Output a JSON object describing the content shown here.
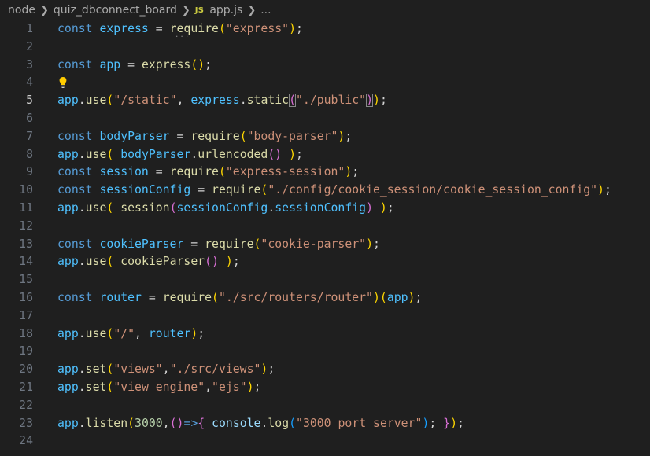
{
  "breadcrumb": {
    "items": [
      "node",
      "quiz_dbconnect_board"
    ],
    "file_icon": "JS",
    "file": "app.js",
    "more": "..."
  },
  "editor": {
    "language": "javascript",
    "current_line": 5,
    "line_numbers": [
      "1",
      "2",
      "3",
      "4",
      "5",
      "6",
      "7",
      "8",
      "9",
      "10",
      "11",
      "12",
      "13",
      "14",
      "15",
      "16",
      "17",
      "18",
      "19",
      "20",
      "21",
      "22",
      "23",
      "24"
    ],
    "lines": [
      "const express = require(\"express\");",
      "",
      "const app = express();",
      "",
      "app.use(\"/static\", express.static(\"./public\"));",
      "",
      "const bodyParser = require(\"body-parser\");",
      "app.use( bodyParser.urlencoded() );",
      "const session = require(\"express-session\");",
      "const sessionConfig = require(\"./config/cookie_session/cookie_session_config\");",
      "app.use( session(sessionConfig.sessionConfig) );",
      "",
      "const cookieParser = require(\"cookie-parser\");",
      "app.use( cookieParser() );",
      "",
      "const router = require(\"./src/routers/router\")(app);",
      "",
      "app.use(\"/\", router);",
      "",
      "app.set(\"views\",\"./src/views\");",
      "app.set(\"view engine\",\"ejs\");",
      "",
      "app.listen(3000,()=>{ console.log(\"3000 port server\"); });",
      ""
    ],
    "lightbulb_icon": "lightbulb-icon",
    "hint_dots": "..."
  },
  "colors": {
    "background": "#1f1f1f",
    "keyword": "#569cd6",
    "variable": "#9cdcfe",
    "constant": "#4fc1ff",
    "function": "#dcdcaa",
    "string": "#ce9178",
    "number": "#b5cea8",
    "bracket_1": "#ffd700",
    "bracket_2": "#da70d6",
    "bracket_3": "#179fff"
  }
}
